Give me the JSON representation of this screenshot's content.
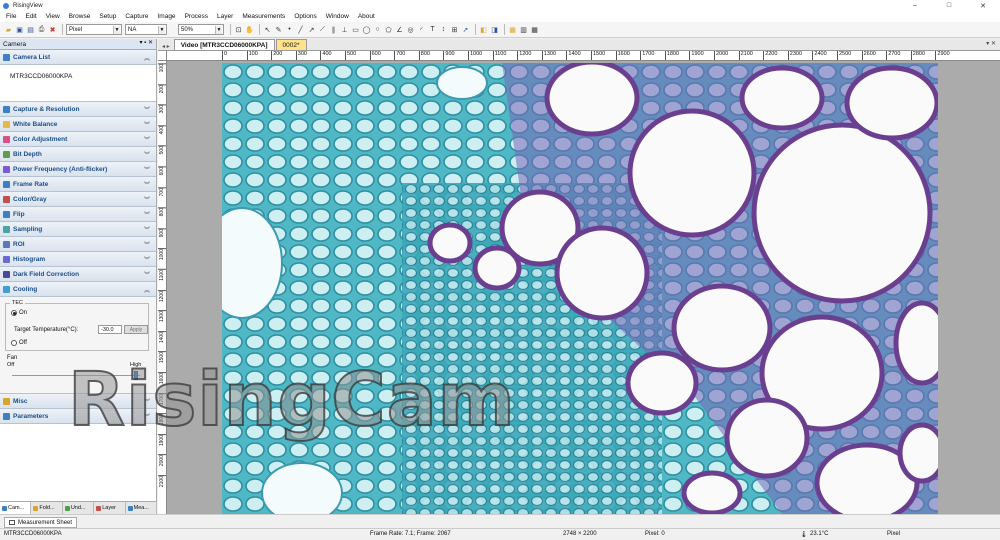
{
  "app": {
    "title": "RisingView"
  },
  "menu": [
    "File",
    "Edit",
    "View",
    "Browse",
    "Setup",
    "Capture",
    "Image",
    "Process",
    "Layer",
    "Measurements",
    "Options",
    "Window",
    "About"
  ],
  "toolbar": {
    "unit": "Pixel",
    "scale": "NA",
    "zoom": "50%"
  },
  "camera_panel": {
    "title": "Camera",
    "camera_list_label": "Camera List",
    "camera_name": "MTR3CCD06000KPA",
    "sections": [
      "Capture & Resolution",
      "White Balance",
      "Color Adjustment",
      "Bit Depth",
      "Power Frequency (Anti-flicker)",
      "Frame Rate",
      "Color/Gray",
      "Flip",
      "Sampling",
      "ROI",
      "Histogram",
      "Dark Field Correction",
      "Cooling"
    ],
    "section_colors": [
      "#3d7fc4",
      "#e6b84a",
      "#d94f8a",
      "#5aa04a",
      "#7b5bd1",
      "#3d7fc4",
      "#c05050",
      "#3d7fc4",
      "#4ba3a3",
      "#5a7ab5",
      "#6a6ad0",
      "#4a4a9a",
      "#3d9fd4"
    ],
    "cooling": {
      "tec_label": "TEC",
      "on_label": "On",
      "off_label": "Off",
      "target_label": "Target Temperature(°C):",
      "target_value": "-30.0",
      "apply_label": "Apply",
      "fan_label": "Fan",
      "fan_off": "Off",
      "fan_high": "High",
      "fan_level_fraction": 0.97
    },
    "after_sections": [
      "Misc",
      "Parameters"
    ]
  },
  "bottom_tabs": [
    "Cam...",
    "Fold...",
    "Und...",
    "Layer",
    "Mea..."
  ],
  "doc_tabs": {
    "video": "Video [MTR3CCD06000KPA]",
    "image": "0002*"
  },
  "hruler_ticks": [
    "0",
    "100",
    "200",
    "300",
    "400",
    "500",
    "600",
    "700",
    "800",
    "900",
    "1000",
    "1100",
    "1200",
    "1300",
    "1400",
    "1500",
    "1600",
    "1700",
    "1800",
    "1900",
    "2000",
    "2100",
    "2200",
    "2300",
    "2400",
    "2500",
    "2600",
    "2700",
    "2800",
    "2900"
  ],
  "vruler_ticks": [
    "100",
    "200",
    "300",
    "400",
    "500",
    "600",
    "700",
    "800",
    "900",
    "1000",
    "1100",
    "1200",
    "1300",
    "1400",
    "1500",
    "1600",
    "1700",
    "1800",
    "1900",
    "2000",
    "2100"
  ],
  "watermark": "RisingCam",
  "measure_tab": "Measurement Sheet",
  "status": {
    "camera": "MTR3CCD06000KPA",
    "frame": "Frame Rate: 7.1; Frame: 2067",
    "resolution": "2748 × 2200",
    "pixel": "Pixel: 0",
    "temp": "23.1°C",
    "unit": "Pixel"
  }
}
